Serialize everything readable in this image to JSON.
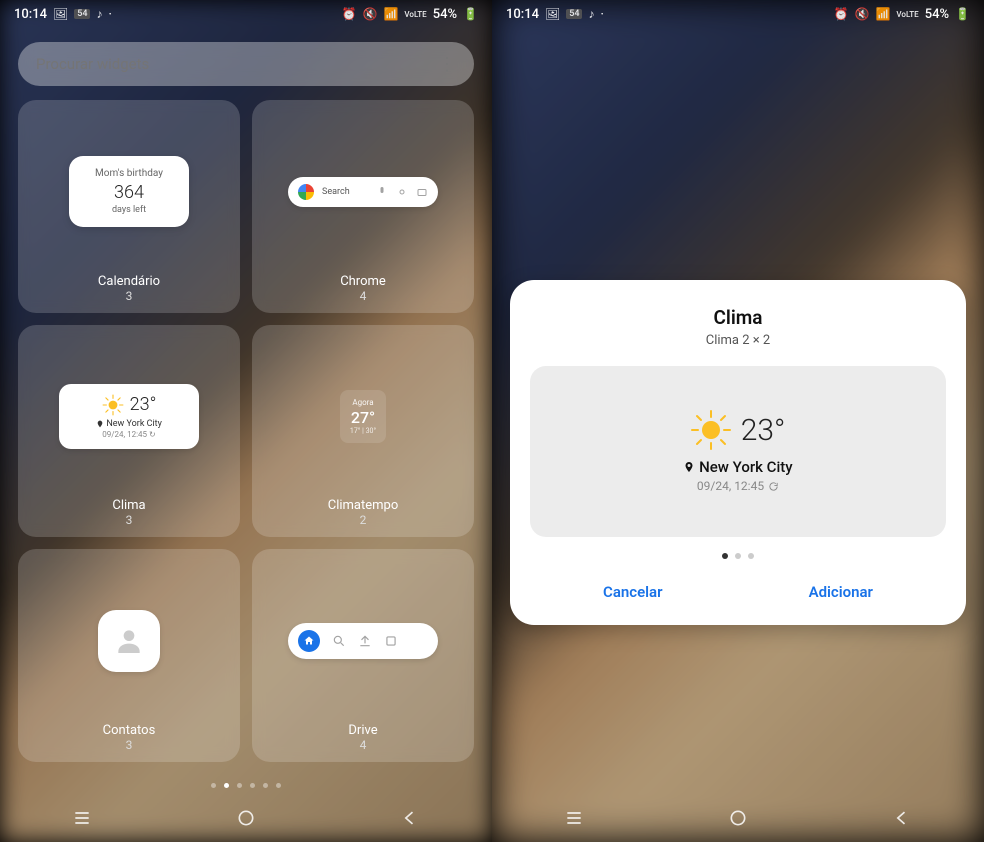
{
  "status": {
    "time": "10:14",
    "left_icons": [
      "image-icon",
      "54-badge",
      "tiktok-icon",
      "more-icon"
    ],
    "right_icons": [
      "alarm-icon",
      "mute-icon",
      "wifi-icon",
      "signal-icon"
    ],
    "battery_text": "54%",
    "network": "VoLTE"
  },
  "search": {
    "placeholder": "Procurar widgets"
  },
  "widgets": [
    {
      "label": "Calendário",
      "count": "3",
      "preview": {
        "line1": "Mom's birthday",
        "line2": "364",
        "line3": "days left"
      }
    },
    {
      "label": "Chrome",
      "count": "4",
      "preview": {
        "search_label": "Search"
      }
    },
    {
      "label": "Clima",
      "count": "3",
      "preview": {
        "temp": "23°",
        "city": "New York City",
        "time": "09/24, 12:45"
      }
    },
    {
      "label": "Climatempo",
      "count": "2",
      "preview": {
        "now": "Agora",
        "temp": "27°",
        "range": "17° | 30°"
      }
    },
    {
      "label": "Contatos",
      "count": "3"
    },
    {
      "label": "Drive",
      "count": "4"
    }
  ],
  "pagination_left": {
    "total": 6,
    "active": 1
  },
  "modal": {
    "title": "Clima",
    "subtitle": "Clima   2 × 2",
    "temp": "23°",
    "city": "New York City",
    "timestamp": "09/24, 12:45",
    "pages": {
      "total": 3,
      "active": 0
    },
    "cancel": "Cancelar",
    "add": "Adicionar"
  },
  "nav": {
    "recent": "|||",
    "home": "○",
    "back": "‹"
  }
}
